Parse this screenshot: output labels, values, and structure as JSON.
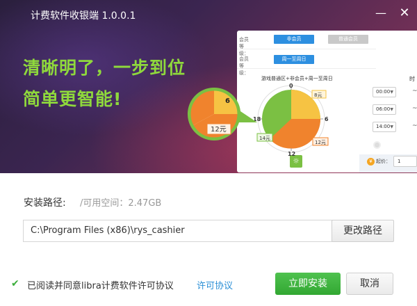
{
  "window": {
    "title": "计费软件收银端 1.0.0.1",
    "minimize_icon": "minimize-icon",
    "close_icon": "close-icon"
  },
  "banner": {
    "slogan_line1": "清晰明了，一步到位",
    "slogan_line2": "简单更智能!",
    "accent_color": "#8fd93c"
  },
  "preview": {
    "member_level_label": "会员等级：",
    "chip_non_member": "非会员",
    "chip_regular_member": "普通会员",
    "member_day_label": "会员等级：",
    "chip_weekdays": "周一至周日",
    "chart_caption": "游戏普通区+非会员+周一至周日",
    "time_header": "时",
    "clock_labels": [
      "0",
      "6",
      "12",
      "18"
    ],
    "price_tags": [
      "8元",
      "12元",
      "14元"
    ],
    "zoom_labels": [
      "6",
      "12元"
    ],
    "time_options": [
      "00:00",
      "06:00",
      "14:00"
    ],
    "start_label": "起价：",
    "start_value": "1",
    "coin_icon": "coin-icon",
    "sun_icon": "sun-icon",
    "gear_icon": "gear-icon"
  },
  "install": {
    "path_label": "安装路径:",
    "free_space": "/可用空间：2.47GB",
    "path_value": "C:\\Program Files (x86)\\rys_cashier",
    "change_path_button": "更改路径",
    "agree_text": "已阅读并同意libra计费软件许可协议",
    "agree_checked": true,
    "license_link": "许可协议",
    "install_button": "立即安装",
    "cancel_button": "取消",
    "install_color": "#3cae3c"
  }
}
